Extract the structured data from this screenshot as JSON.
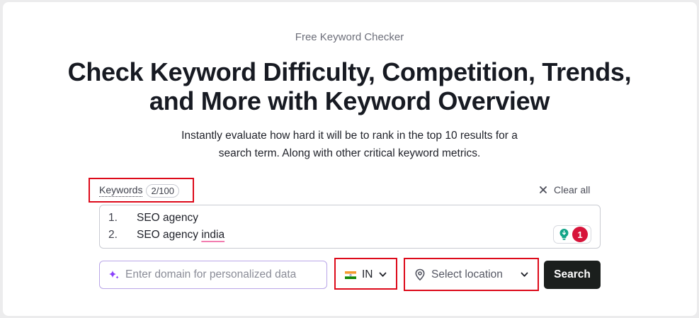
{
  "header": {
    "eyebrow": "Free Keyword Checker",
    "title_line_1": "Check Keyword Difficulty, Competition, Trends,",
    "title_line_2": "and More with Keyword Overview",
    "subtitle_line_1": "Instantly evaluate how hard it will be to rank in the top 10 results for a",
    "subtitle_line_2": "search term. Along with other critical keyword metrics."
  },
  "keywords": {
    "label": "Keywords",
    "count": "2/100",
    "clear_all": "Clear all",
    "items": [
      {
        "number": "1.",
        "text": "SEO agency",
        "squiggle": ""
      },
      {
        "number": "2.",
        "text": "SEO agency ",
        "squiggle": "india"
      }
    ],
    "suggestion_badge_count": "1"
  },
  "domain_input": {
    "placeholder": "Enter domain for personalized data",
    "value": ""
  },
  "country": {
    "selected": "IN",
    "flag_icon": "india-flag-icon"
  },
  "location": {
    "placeholder": "Select location"
  },
  "search": {
    "label": "Search"
  },
  "colors": {
    "highlight_red": "#dd0a1a",
    "search_button_bg": "#1b1f1d",
    "badge_red": "#d7143a",
    "bulb_teal": "#12a588",
    "sparkle_purple": "#8a3ffc"
  }
}
